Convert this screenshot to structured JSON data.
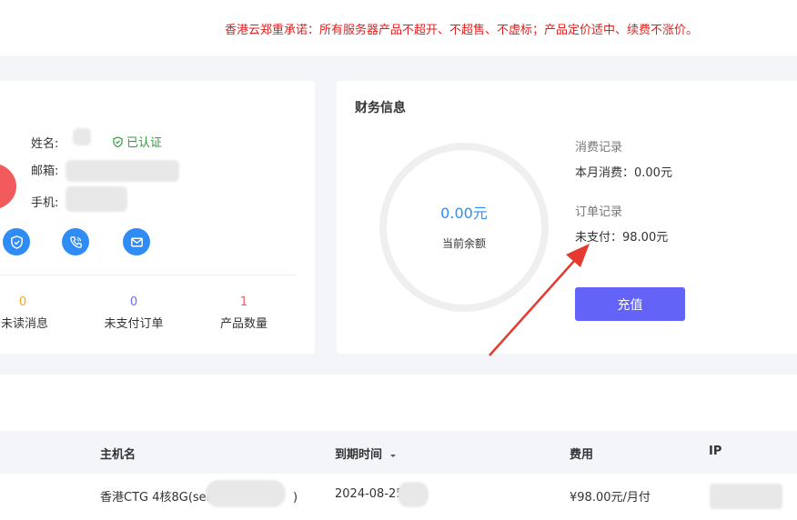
{
  "notice": {
    "text": "香港云郑重承诺：所有服务器产品不超开、不超售、不虚标；产品定价适中、续费不涨价。"
  },
  "profile": {
    "name_label": "姓名:",
    "email_label": "邮箱:",
    "phone_label": "手机:",
    "verified_text": "已认证",
    "icons": [
      "shield-check-icon",
      "phone-icon",
      "mail-icon"
    ]
  },
  "stats": [
    {
      "value": "0",
      "label": "未读消息",
      "color": "#f5a623"
    },
    {
      "value": "0",
      "label": "未支付订单",
      "color": "#6b6bf5"
    },
    {
      "value": "1",
      "label": "产品数量",
      "color": "#f25b5b"
    }
  ],
  "finance": {
    "title": "财务信息",
    "balance_value": "0.00元",
    "balance_label": "当前余额",
    "consumption_title": "消费记录",
    "consumption_text": "本月消费：0.00元",
    "order_title": "订单记录",
    "order_text": "未支付：98.00元",
    "recharge_label": "充值"
  },
  "table": {
    "headers": [
      "主机名",
      "到期时间",
      "费用",
      "IP"
    ],
    "rows": [
      {
        "host": "香港CTG 4核8G(ser",
        "host_suffix": ")",
        "expire": "2024-08-25",
        "fee": "¥98.00元/月付"
      }
    ]
  },
  "colors": {
    "accent": "#2f8cf5",
    "button": "#6363f7",
    "notice": "#e02020",
    "verified": "#2e9b3a"
  }
}
